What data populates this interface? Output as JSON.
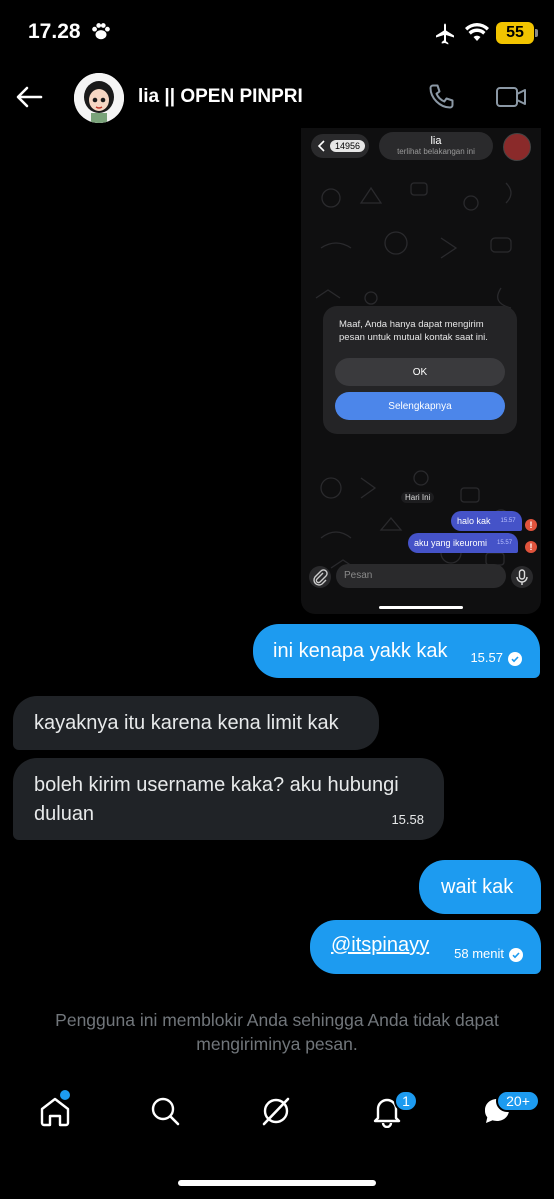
{
  "status_bar": {
    "time": "17.28",
    "battery": "55"
  },
  "header": {
    "title": "lia || OPEN PINPRI"
  },
  "embedded_screenshot": {
    "back_count": "14956",
    "contact_name": "lia",
    "contact_status": "terlihat belakangan ini",
    "dialog_text": "Maaf, Anda hanya dapat mengirim pesan untuk mutual kontak saat ini.",
    "ok_label": "OK",
    "more_label": "Selengkapnya",
    "day_label": "Hari Ini",
    "messages": [
      {
        "text": "halo kak",
        "time": "15.57"
      },
      {
        "text": "aku yang ikeuromi",
        "time": "15.57"
      }
    ],
    "input_placeholder": "Pesan"
  },
  "messages": [
    {
      "direction": "out",
      "text": "ini kenapa yakk kak",
      "time": "15.57"
    },
    {
      "direction": "in",
      "text": "kayaknya itu karena kena limit kak"
    },
    {
      "direction": "in",
      "text": "boleh kirim username kaka? aku hubungi duluan",
      "time": "15.58"
    },
    {
      "direction": "out",
      "text": "wait kak"
    },
    {
      "direction": "out",
      "text": "@itspinayy",
      "time": "58 menit"
    }
  ],
  "blocked_notice": "Pengguna ini memblokir Anda sehingga Anda tidak dapat mengiriminya pesan.",
  "nav": {
    "notifications_badge": "1",
    "messages_badge": "20+"
  },
  "colors": {
    "accent": "#1d9bf0",
    "incoming_bubble": "#202327",
    "background": "#000000"
  }
}
